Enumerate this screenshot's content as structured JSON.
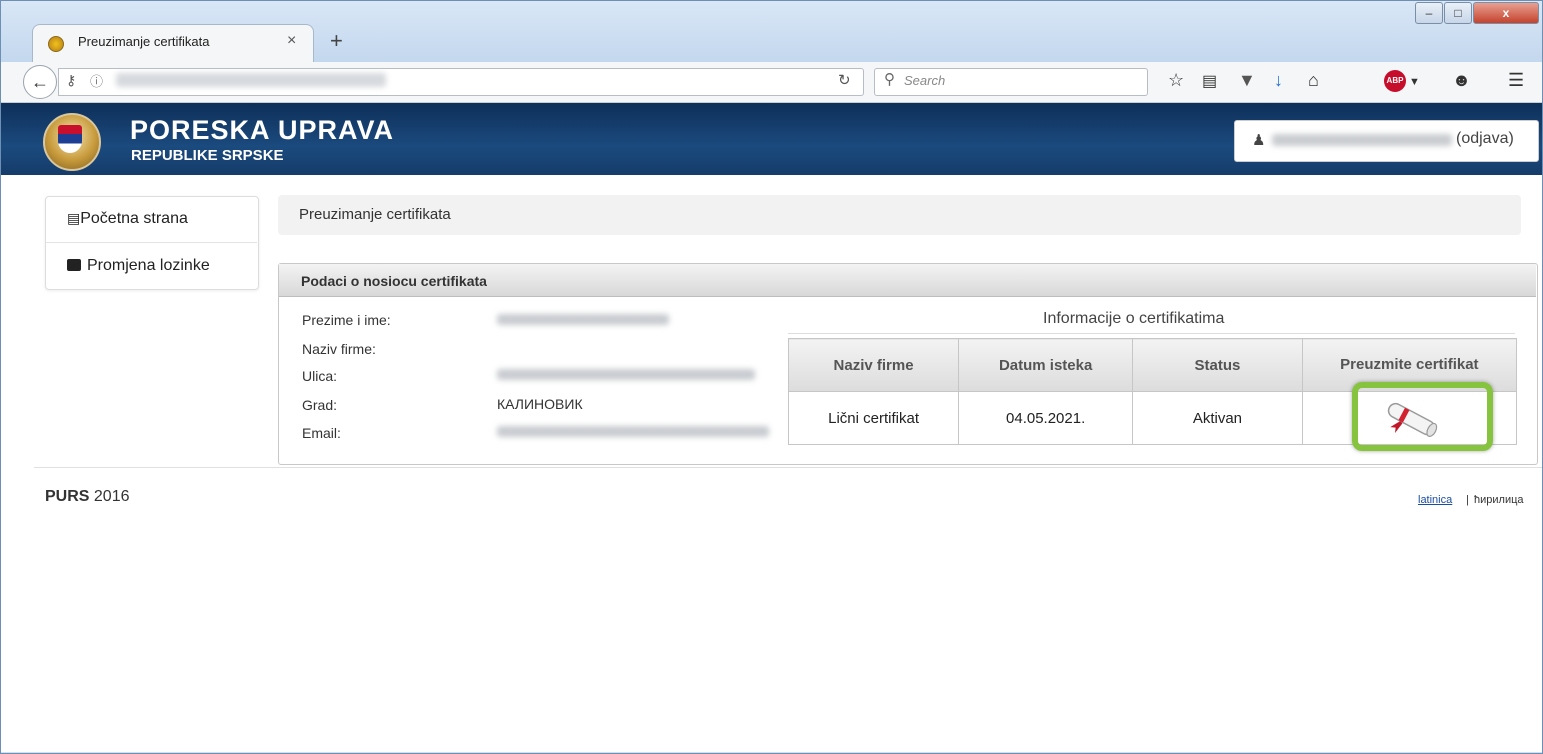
{
  "browser": {
    "tab_title": "Preuzimanje certifikata",
    "tab_close": "×",
    "new_tab": "+",
    "window_buttons": [
      "–",
      "□",
      "x"
    ],
    "search_placeholder": "Search",
    "icons": [
      "star-icon",
      "reading-list-icon",
      "pocket-icon",
      "download-icon",
      "home-icon",
      "adblock-icon",
      "chat-icon",
      "menu-icon"
    ]
  },
  "header": {
    "brand_line1": "PORESKA UPRAVA",
    "brand_line2": "REPUBLIKE SRPSKE",
    "logout": "(odjava)"
  },
  "sidebar": {
    "items": [
      {
        "label": "Početna strana",
        "icon": "list-icon"
      },
      {
        "label": "Promjena lozinke",
        "icon": "briefcase-icon"
      }
    ]
  },
  "breadcrumb": "Preuzimanje certifikata",
  "panel": {
    "title": "Podaci o nosiocu certifikata",
    "fields": [
      {
        "label": "Prezime i ime:"
      },
      {
        "label": "Naziv firme:"
      },
      {
        "label": "Ulica:"
      },
      {
        "label": "Grad:",
        "value": "КАЛИНОВИК"
      },
      {
        "label": "Email:"
      }
    ],
    "info_title": "Informacije o certifikatima",
    "table": {
      "headers": [
        "Naziv firme",
        "Datum isteka",
        "Status",
        "Preuzmite certifikat"
      ],
      "rows": [
        {
          "naziv": "Lični certifikat",
          "datum": "04.05.2021.",
          "status": "Aktivan"
        }
      ]
    }
  },
  "footer": {
    "left_brand": "PURS",
    "left_year": "2016",
    "lang_latin": "latinica",
    "lang_sep": "|",
    "lang_cyrillic": "ћирилица"
  },
  "colors": {
    "header_blue": "#1b4a7e",
    "highlight_green": "#86c440",
    "adblock_red": "#c70d2c"
  }
}
